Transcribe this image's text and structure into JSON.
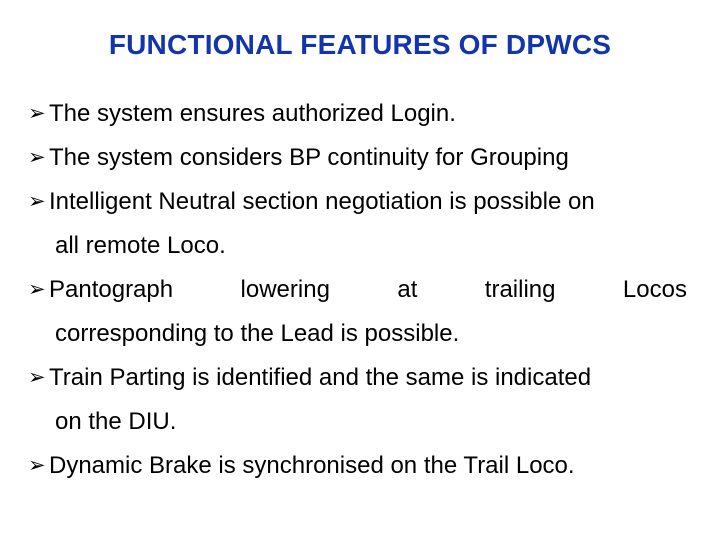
{
  "slide": {
    "title": "FUNCTIONAL FEATURES OF DPWCS",
    "title_color": "#1234ad",
    "body_color": "#000000",
    "background_color": "#ffffff",
    "bullet_glyph": "➢",
    "bullet_icon_name": "arrowhead-bullet-icon",
    "bullets": [
      {
        "lines": [
          "The system ensures authorized Login."
        ],
        "justified_words": null
      },
      {
        "lines": [
          "The system considers BP continuity for Grouping"
        ],
        "justified_words": null
      },
      {
        "lines": [
          "Intelligent Neutral section negotiation is possible on",
          "all remote Loco."
        ],
        "justified_words": null
      },
      {
        "lines": [
          "Pantograph lowering at trailing Locos",
          "corresponding to the Lead is possible."
        ],
        "justified_words": [
          "Pantograph",
          "lowering",
          "at",
          "trailing",
          "Locos"
        ]
      },
      {
        "lines": [
          "Train Parting is identified and the same is indicated",
          "on the DIU."
        ],
        "justified_words": null
      },
      {
        "lines": [
          "Dynamic Brake is synchronised on the Trail Loco."
        ],
        "justified_words": null
      }
    ]
  }
}
